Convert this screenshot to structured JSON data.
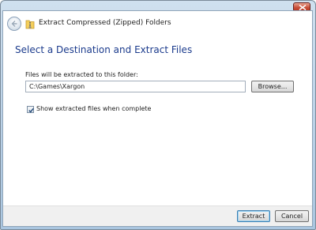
{
  "window": {
    "title": "Extract Compressed (Zipped) Folders"
  },
  "main": {
    "heading": "Select a Destination and Extract Files",
    "folder_label": "Files will be extracted to this folder:",
    "path_value": "C:\\Games\\Xargon",
    "browse_label": "Browse...",
    "checkbox_label": "Show extracted files when complete",
    "checkbox_checked": true
  },
  "footer": {
    "extract_label": "Extract",
    "cancel_label": "Cancel"
  },
  "icons": {
    "close": "close-icon",
    "back": "back-arrow-icon",
    "zip": "zip-folder-icon",
    "check": "checkmark-icon"
  },
  "colors": {
    "heading": "#1a3a8c",
    "close_button": "#c8503a",
    "default_button_border": "#3c7fb1"
  }
}
